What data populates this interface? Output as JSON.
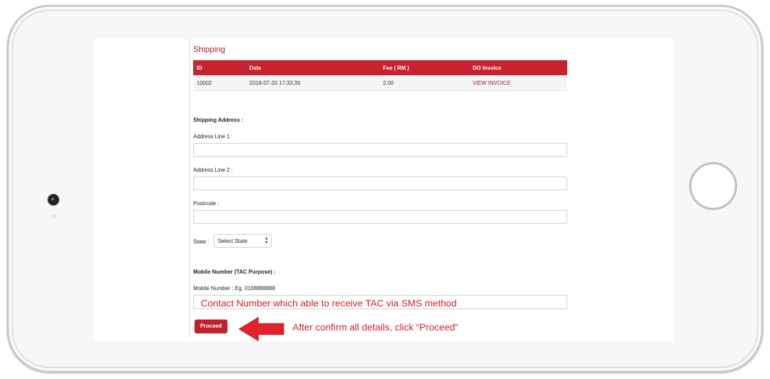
{
  "shipping": {
    "title": "Shipping",
    "columns": [
      "ID",
      "Date",
      "Fee ( RM )",
      "DO Invoice"
    ],
    "rows": [
      {
        "id": "10002",
        "date": "2018-07-20 17:33:39",
        "fee": "2.00",
        "invoice": "VIEW INVOICE"
      }
    ]
  },
  "form": {
    "shipping_address_heading": "Shipping Address :",
    "address1_label": "Address Line 1 :",
    "address2_label": "Address Line 2 :",
    "postcode_label": "Postcode :",
    "state_label": "State :",
    "state_selected": "Select State",
    "mobile_heading": "Mobile Number (TAC Purpose) :",
    "mobile_label": "Mobile Number : Eg. 0168888888",
    "proceed_label": "Proceed"
  },
  "annotations": {
    "mobile_hint": "Contact Number which able to receive TAC via SMS method",
    "proceed_hint": "After confirm all details, click “Proceed”"
  },
  "colors": {
    "accent": "#c8222f",
    "annotation": "#d0202a"
  }
}
